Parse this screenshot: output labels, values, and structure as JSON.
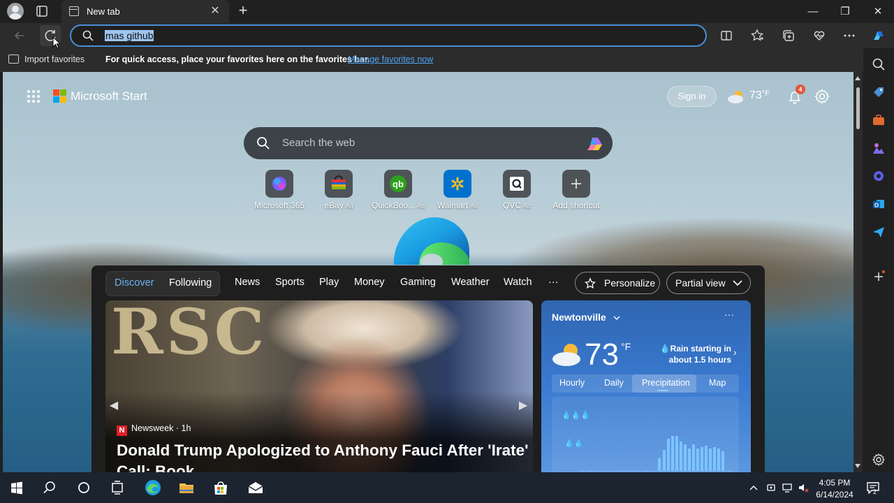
{
  "browser": {
    "tab_title": "New tab",
    "tab_close": "✕",
    "new_tab": "+",
    "window_controls": {
      "minimize": "—",
      "restore": "❐",
      "close": "✕"
    }
  },
  "address_bar": {
    "value": "mas github"
  },
  "favorites_bar": {
    "import_label": "Import favorites",
    "note": "For quick access, place your favorites here on the favorites bar.",
    "manage_link": "Manage favorites now"
  },
  "start": {
    "brand": "Microsoft Start",
    "sign_in": "Sign in",
    "weather_temp": "73",
    "weather_unit": "°F",
    "notification_count": "4",
    "search_placeholder": "Search the web",
    "shortcuts": [
      {
        "label": "Microsoft 365",
        "ad": "",
        "icon": "microsoft-365-icon"
      },
      {
        "label": "eBay",
        "ad": "Ad",
        "icon": "ebay-icon"
      },
      {
        "label": "QuickBoo...",
        "ad": "Ad",
        "icon": "quickbooks-icon"
      },
      {
        "label": "Walmart",
        "ad": "Ad",
        "icon": "walmart-icon"
      },
      {
        "label": "QVC",
        "ad": "Ad",
        "icon": "qvc-icon"
      },
      {
        "label": "Add shortcut",
        "ad": "",
        "icon": "add-icon"
      }
    ]
  },
  "feed": {
    "tabs": [
      "Discover",
      "Following"
    ],
    "nav": [
      "News",
      "Sports",
      "Play",
      "Money",
      "Gaming",
      "Weather",
      "Watch",
      "···"
    ],
    "personalize": "Personalize",
    "view_mode": "Partial view",
    "hero": {
      "letters": "RSC",
      "source": "Newsweek",
      "age": "· 1h",
      "source_logo": "N",
      "title": "Donald Trump Apologized to Anthony Fauci After 'Irate' Call: Book"
    }
  },
  "weather_card": {
    "location": "Newtonville",
    "more": "···",
    "temp": "73",
    "unit": "°F",
    "rain_line1": "Rain starting in",
    "rain_line2": "about 1.5 hours",
    "tabs": [
      "Hourly",
      "Daily",
      "Precipitation",
      "Map"
    ],
    "active_tab": "Precipitation"
  },
  "taskbar": {
    "time": "4:05 PM",
    "date": "6/14/2024",
    "notification_count": "2"
  },
  "colors": {
    "accent": "#4a8ed8",
    "link": "#4fa6f5",
    "active_tab_text": "#6cb0f3",
    "badge": "#e3563b"
  }
}
